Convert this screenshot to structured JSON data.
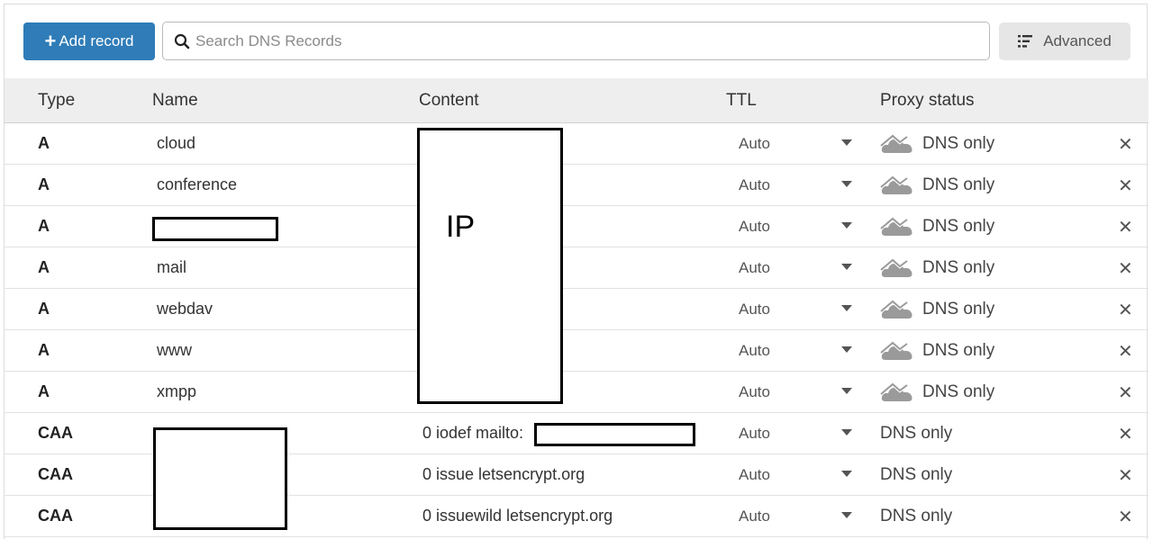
{
  "toolbar": {
    "add_label": "Add record",
    "search_placeholder": "Search DNS Records",
    "advanced_label": "Advanced"
  },
  "table": {
    "headers": {
      "type": "Type",
      "name": "Name",
      "content": "Content",
      "ttl": "TTL",
      "proxy": "Proxy status"
    },
    "rows": [
      {
        "type": "A",
        "name": "cloud",
        "content": "",
        "ttl": "Auto",
        "proxy": "DNS only",
        "proxy_icon": "cloud-icon"
      },
      {
        "type": "A",
        "name": "conference",
        "content": "",
        "ttl": "Auto",
        "proxy": "DNS only",
        "proxy_icon": "cloud-icon"
      },
      {
        "type": "A",
        "name": "",
        "content": "",
        "ttl": "Auto",
        "proxy": "DNS only",
        "proxy_icon": "cloud-icon"
      },
      {
        "type": "A",
        "name": "mail",
        "content": "",
        "ttl": "Auto",
        "proxy": "DNS only",
        "proxy_icon": "cloud-icon"
      },
      {
        "type": "A",
        "name": "webdav",
        "content": "",
        "ttl": "Auto",
        "proxy": "DNS only",
        "proxy_icon": "cloud-icon"
      },
      {
        "type": "A",
        "name": "www",
        "content": "",
        "ttl": "Auto",
        "proxy": "DNS only",
        "proxy_icon": "cloud-icon"
      },
      {
        "type": "A",
        "name": "xmpp",
        "content": "",
        "ttl": "Auto",
        "proxy": "DNS only",
        "proxy_icon": "cloud-icon"
      },
      {
        "type": "CAA",
        "name": "",
        "content": "0 iodef mailto:",
        "ttl": "Auto",
        "proxy": "DNS only",
        "proxy_icon": ""
      },
      {
        "type": "CAA",
        "name": "",
        "content": "0 issue letsencrypt.org",
        "ttl": "Auto",
        "proxy": "DNS only",
        "proxy_icon": ""
      },
      {
        "type": "CAA",
        "name": "",
        "content": "0 issuewild letsencrypt.org",
        "ttl": "Auto",
        "proxy": "DNS only",
        "proxy_icon": ""
      }
    ]
  },
  "annotations": {
    "ip_label": "IP"
  },
  "colors": {
    "primary": "#2f7cb8",
    "header_bg": "#eeeeee",
    "advanced_bg": "#e6e6e6",
    "cloud_gray": "#9a9a9a"
  }
}
